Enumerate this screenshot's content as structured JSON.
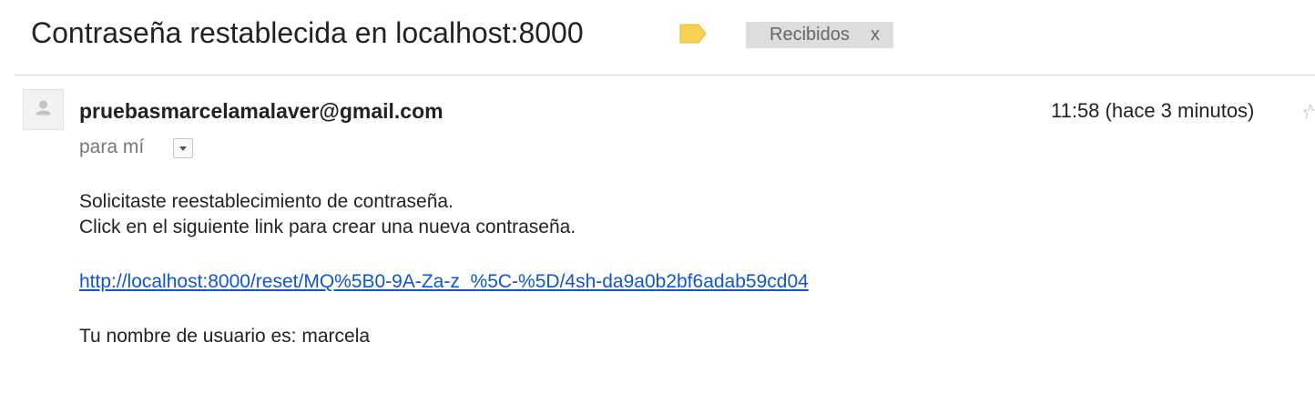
{
  "message": {
    "subject": "Contraseña restablecida en localhost:8000",
    "label": {
      "name": "Recibidos",
      "remove": "x"
    },
    "sender": "pruebasmarcelamalaver@gmail.com",
    "time": "11:58 (hace 3 minutos)",
    "recipient": "para mí",
    "body": {
      "line1": "Solicitaste reestablecimiento de contraseña.",
      "line2": "Click en el siguiente link para crear una nueva contraseña.",
      "link": "http://localhost:8000/reset/MQ%5B0-9A-Za-z_%5C-%5D/4sh-da9a0b2bf6adab59cd04",
      "line3": "Tu nombre de usuario es: marcela"
    }
  },
  "icons": {
    "importance": "label-tag-icon",
    "avatar": "person-icon",
    "star": "star-icon",
    "dropdown": "chevron-down-icon"
  },
  "colors": {
    "importance_tag": "#f7d154",
    "link": "#1155cc",
    "chip_background": "#dddddd"
  }
}
